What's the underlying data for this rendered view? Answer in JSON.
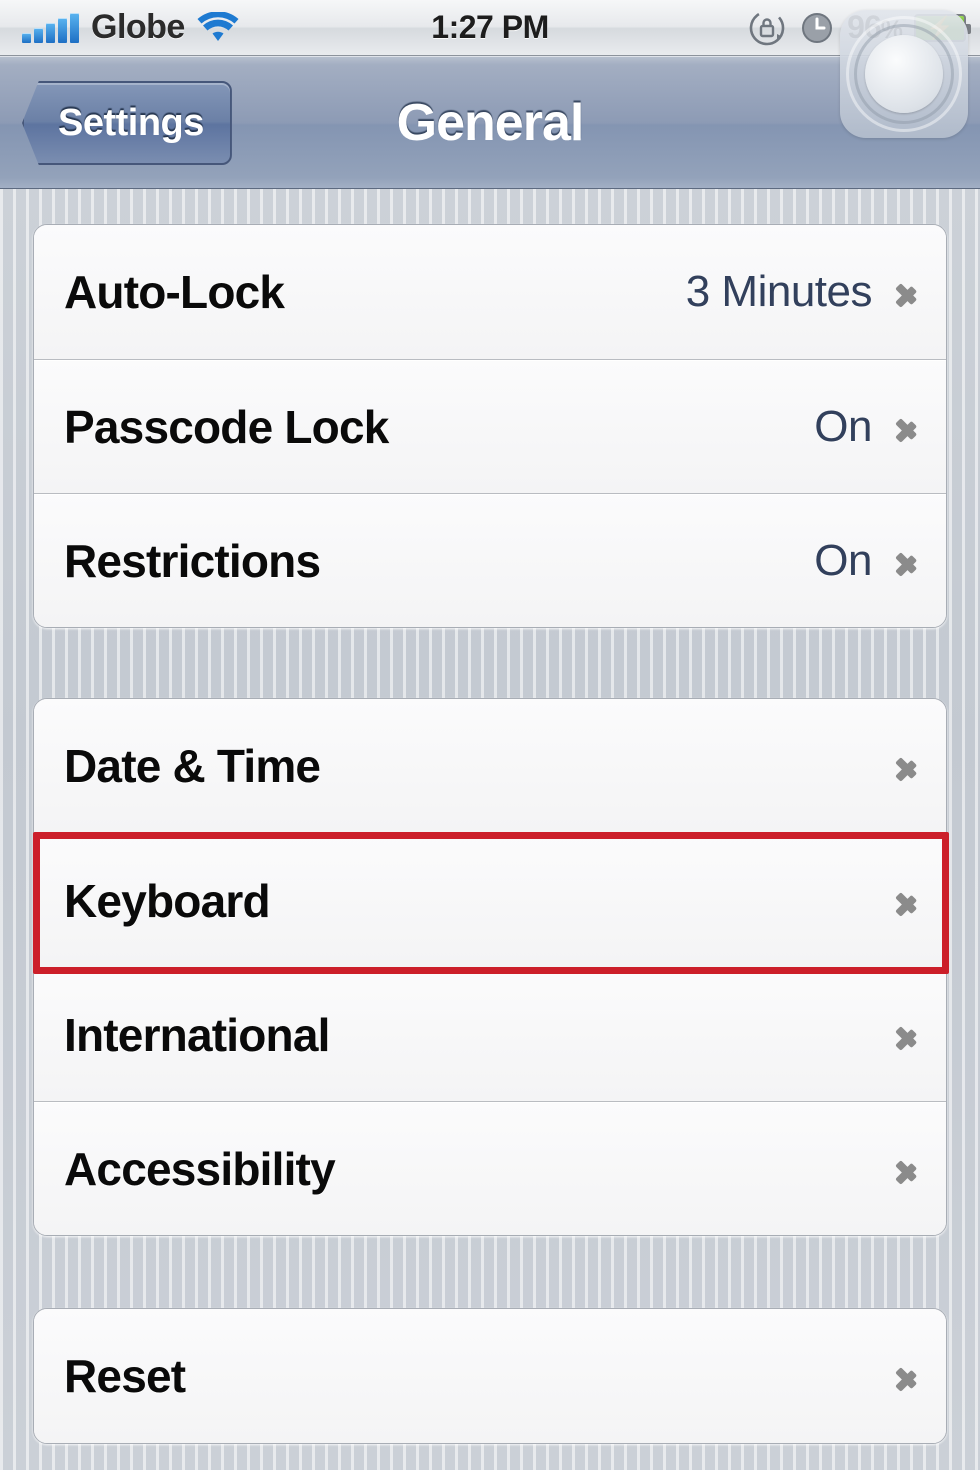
{
  "status_bar": {
    "signal_icon": "signal-bars-icon",
    "signal_bars": 5,
    "carrier": "Globe",
    "wifi_icon": "wifi-icon",
    "time": "1:27 PM",
    "rotation_lock_icon": "rotation-lock-icon",
    "alarm_icon": "alarm-clock-icon",
    "battery_percent": "96",
    "percent_symbol": "%",
    "battery_icon": "battery-charging-icon",
    "charging_bolt": "⚡"
  },
  "nav_bar": {
    "back_label": "Settings",
    "title": "General",
    "assistive_touch_icon": "assistive-touch-button"
  },
  "groups": [
    {
      "id": "security-group",
      "rows": [
        {
          "label": "Auto-Lock",
          "value": "3 Minutes",
          "name": "auto-lock"
        },
        {
          "label": "Passcode Lock",
          "value": "On",
          "name": "passcode-lock"
        },
        {
          "label": "Restrictions",
          "value": "On",
          "name": "restrictions"
        }
      ]
    },
    {
      "id": "preferences-group",
      "rows": [
        {
          "label": "Date & Time",
          "value": "",
          "name": "date-and-time"
        },
        {
          "label": "Keyboard",
          "value": "",
          "name": "keyboard"
        },
        {
          "label": "International",
          "value": "",
          "name": "international"
        },
        {
          "label": "Accessibility",
          "value": "",
          "name": "accessibility"
        }
      ]
    },
    {
      "id": "reset-group",
      "rows": [
        {
          "label": "Reset",
          "value": "",
          "name": "reset"
        }
      ]
    }
  ],
  "annotation": {
    "target": "Keyboard",
    "color": "#cc1f2a",
    "shape": "rectangle-outline"
  },
  "colors": {
    "accent_blue": "#1e6fc4",
    "value_text": "#32405c",
    "nav_bar": "#8d9bb5",
    "background": "#c5cad2",
    "highlight_red": "#cc1f2a"
  }
}
